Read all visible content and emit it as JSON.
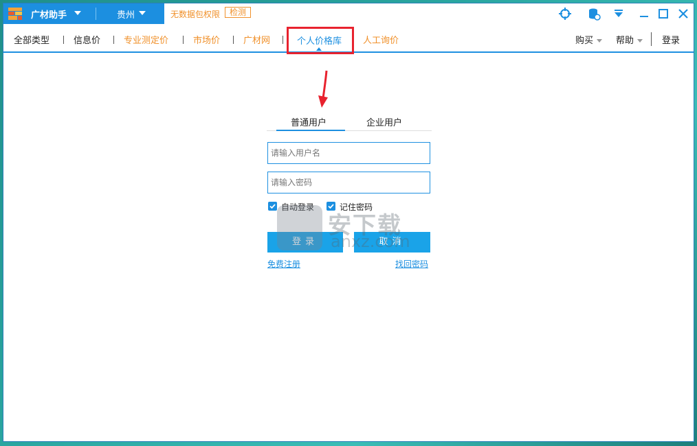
{
  "titlebar": {
    "app_name": "广材助手",
    "city": "贵州",
    "notice": "无数据包权限",
    "check_label": "检测"
  },
  "nav": {
    "items": [
      "全部类型",
      "信息价",
      "专业测定价",
      "市场价",
      "广材网",
      "个人价格库",
      "人工询价"
    ],
    "right": {
      "buy": "购买",
      "help": "帮助",
      "login": "登录"
    }
  },
  "login": {
    "tabs": [
      "普通用户",
      "企业用户"
    ],
    "username_placeholder": "请输入用户名",
    "password_placeholder": "请输入密码",
    "auto_login": "自动登录",
    "remember": "记住密码",
    "login_button": "登录",
    "cancel_button": "取消",
    "register_link": "免费注册",
    "recover_link": "找回密码"
  },
  "watermark": {
    "text": "安下载",
    "url": "anxz.com"
  },
  "colors": {
    "accent": "#1c8fe0",
    "orange": "#f0902a",
    "highlight": "#e8222e"
  }
}
